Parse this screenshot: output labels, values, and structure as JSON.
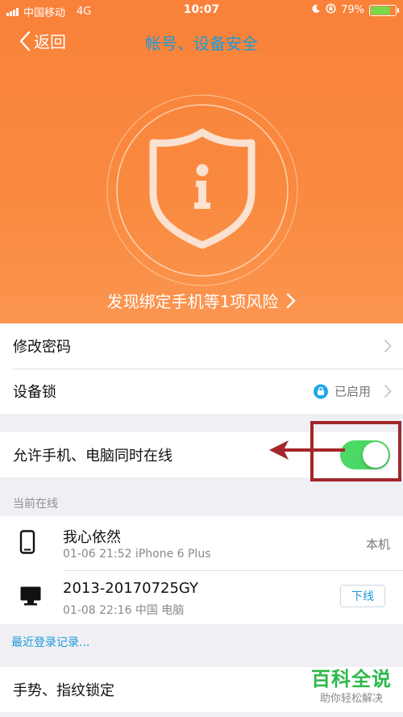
{
  "status_bar": {
    "carrier": "中国移动",
    "network": "4G",
    "time": "10:07",
    "battery": "79%",
    "battery_level": 0.79
  },
  "nav": {
    "back_label": "返回",
    "title": "帐号、设备安全"
  },
  "hero": {
    "risk_text": "发现绑定手机等1项风险"
  },
  "settings": {
    "change_password": "修改密码",
    "device_lock": "设备锁",
    "device_lock_status": "已启用",
    "allow_online": "允许手机、电脑同时在线",
    "allow_online_enabled": true
  },
  "online": {
    "section_label": "当前在线",
    "devices": [
      {
        "name": "我心依然",
        "meta": "01-06 21:52  iPhone 6 Plus",
        "tag": "本机",
        "icon": "phone-icon"
      },
      {
        "name": "2013-20170725GY",
        "meta": "01-08 22:16 中国 电脑",
        "action": "下线",
        "icon": "desktop-icon"
      }
    ],
    "recent_login_link": "最近登录记录..."
  },
  "more": {
    "gesture_lock": "手势、指纹锁定"
  },
  "watermark": {
    "title": "百科全说",
    "subtitle": "助你轻松解决"
  },
  "colors": {
    "hero_orange": "#f98a3f",
    "link_blue": "#1a9bd8",
    "toggle_green": "#4cd864",
    "annotation_red": "#a3262a",
    "watermark_green": "#2db84a"
  }
}
